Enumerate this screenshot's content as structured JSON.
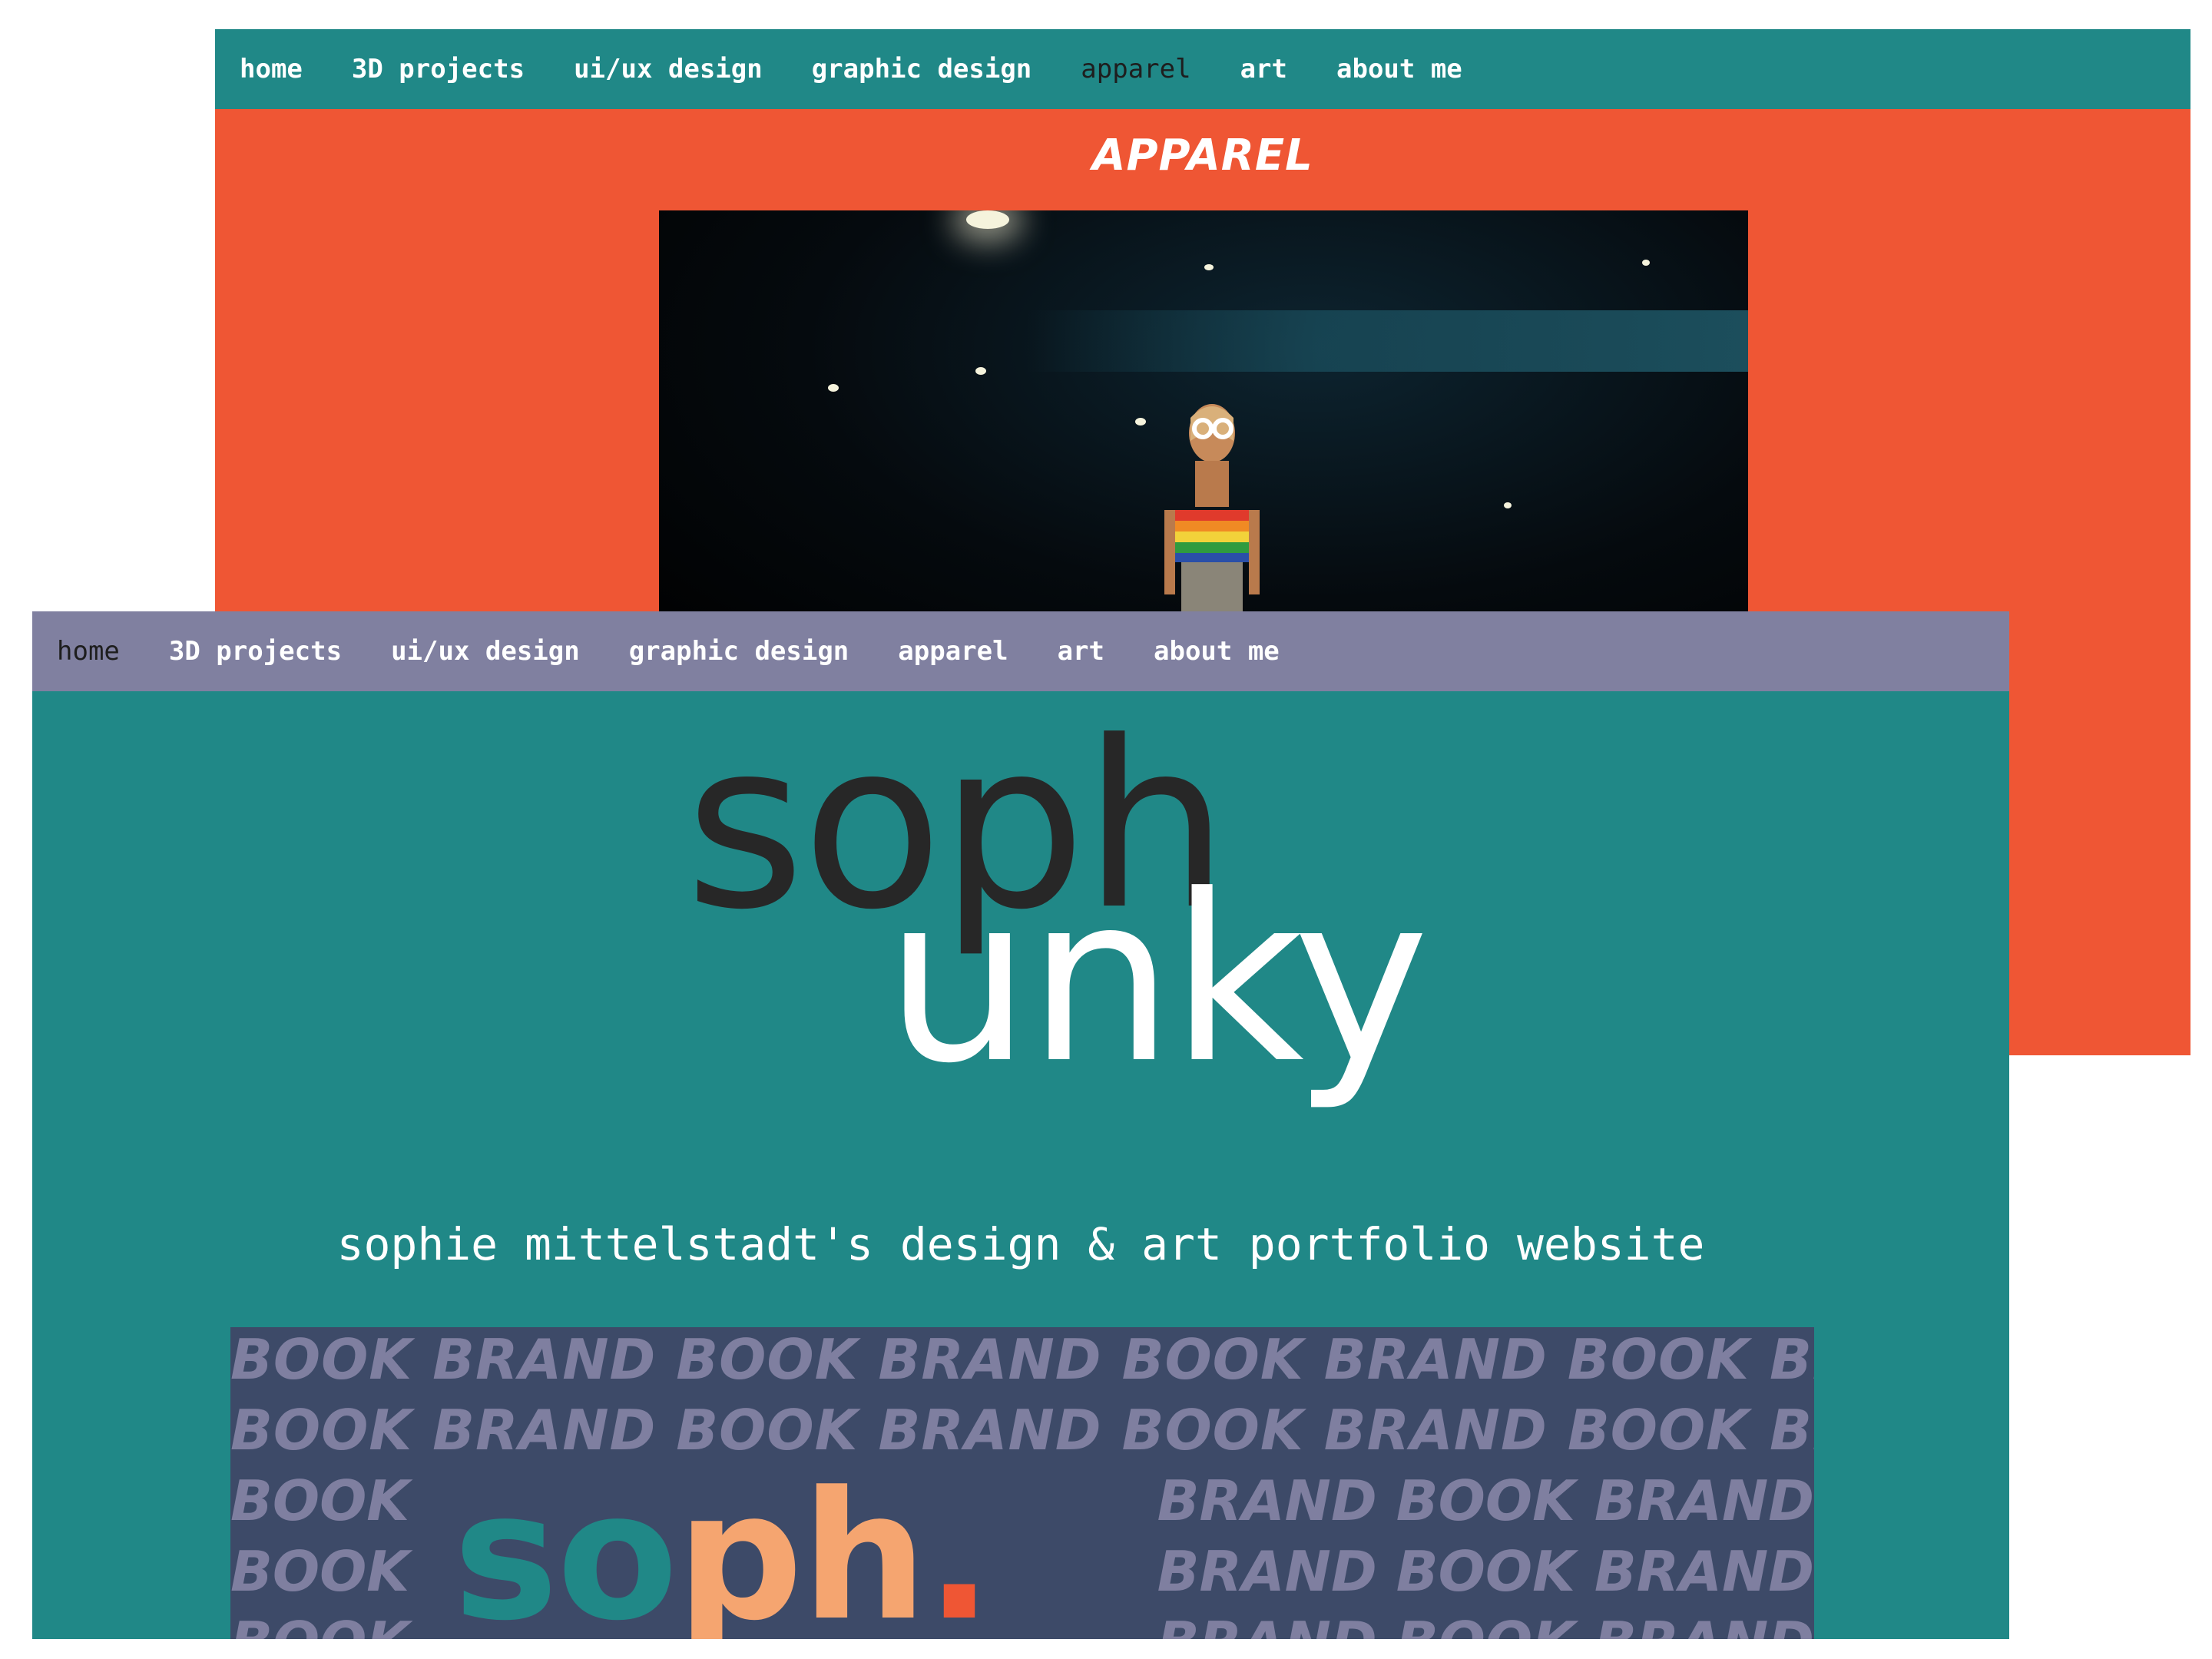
{
  "nav_items": [
    "home",
    "3D projects",
    "ui/ux design",
    "graphic design",
    "apparel",
    "art",
    "about me"
  ],
  "back_window": {
    "active_nav": "apparel",
    "page_title": "APPAREL",
    "colors": {
      "nav_bg": "#208887",
      "page_bg": "#ef5634"
    }
  },
  "front_window": {
    "active_nav": "home",
    "logo_top": "soph",
    "logo_bottom": "unky",
    "tagline": "sophie mittelstadt's design & art portfolio website",
    "colors": {
      "nav_bg": "#8080a0",
      "page_bg": "#208887",
      "logo_dark": "#272727",
      "logo_light": "#ffffff"
    }
  },
  "brand_book": {
    "repeat_full": "BOOK BRAND BOOK BRAND BOOK BRAND BOOK BRAND",
    "repeat_left": "BOOK",
    "repeat_right": "BRAND BOOK BRAND",
    "logo_letters": [
      {
        "char": "s",
        "color": "#208887"
      },
      {
        "char": "o",
        "color": "#208887"
      },
      {
        "char": "p",
        "color": "#f5a570"
      },
      {
        "char": "h",
        "color": "#f5a570"
      },
      {
        "char": ".",
        "color": "#ef5634"
      }
    ],
    "colors": {
      "bg": "#3d4a68",
      "text": "#7f7fa0"
    }
  }
}
